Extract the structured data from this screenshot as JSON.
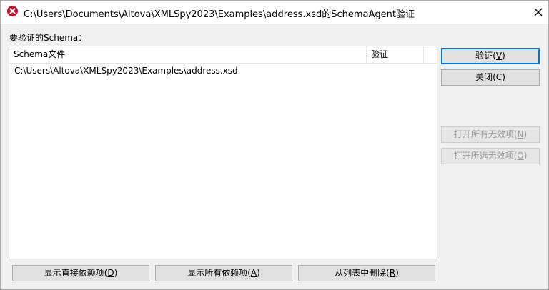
{
  "window": {
    "title": "C:\\Users\\Documents\\Altova\\XMLSpy2023\\Examples\\address.xsd的SchemaAgent验证",
    "icon": "altova-app-icon",
    "close_icon": "close-icon"
  },
  "section_label": "要验证的Schema：",
  "table": {
    "columns": [
      "Schema文件",
      "验证"
    ],
    "rows": [
      {
        "file": "C:\\Users\\Altova\\XMLSpy2023\\Examples\\address.xsd",
        "validate": ""
      }
    ]
  },
  "buttons": {
    "validate": {
      "text": "验证(",
      "key": "V",
      "end": ")"
    },
    "close": {
      "text": "关闭(",
      "key": "C",
      "end": ")"
    },
    "open_all_invalid": {
      "text": "打开所有无效项(",
      "key": "N",
      "end": ")"
    },
    "open_selected_invalid": {
      "text": "打开所选无效项(",
      "key": "O",
      "end": ")"
    },
    "show_direct_deps": {
      "text": "显示直接依赖项(",
      "key": "D",
      "end": ")"
    },
    "show_all_deps": {
      "text": "显示所有依赖项(",
      "key": "A",
      "end": ")"
    },
    "remove_from_list": {
      "text": "从列表中删除(",
      "key": "R",
      "end": ")"
    }
  },
  "colors": {
    "accent": "#0078d7",
    "icon_red": "#c8102e"
  }
}
